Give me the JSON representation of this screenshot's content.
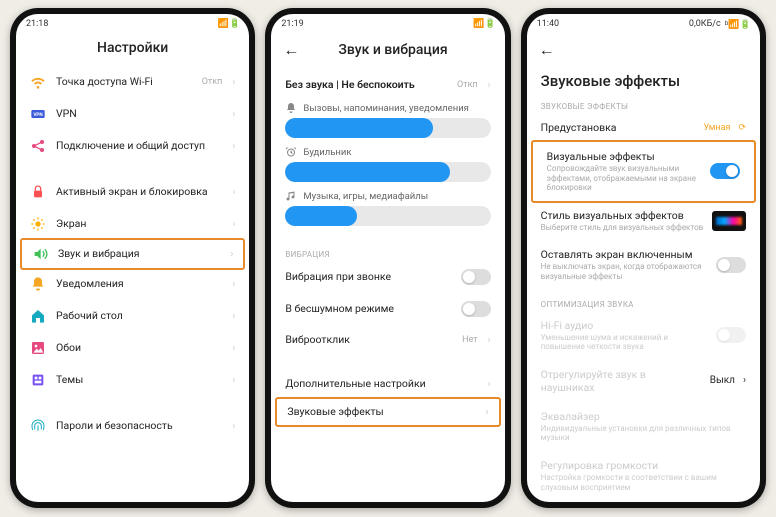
{
  "screen1": {
    "time": "21:18",
    "title": "Настройки",
    "rows": [
      {
        "icon": "wifi",
        "label": "Точка доступа Wi-Fi",
        "value": "Откп"
      },
      {
        "icon": "vpn",
        "label": "VPN"
      },
      {
        "icon": "share",
        "label": "Подключение и общий доступ"
      },
      {
        "gap": true
      },
      {
        "icon": "lock",
        "label": "Активный экран и блокировка"
      },
      {
        "icon": "brightness",
        "label": "Экран"
      },
      {
        "icon": "sound",
        "label": "Звук и вибрация",
        "highlight": true
      },
      {
        "icon": "bell",
        "label": "Уведомления"
      },
      {
        "icon": "home",
        "label": "Рабочий стол"
      },
      {
        "icon": "wallpaper",
        "label": "Обои"
      },
      {
        "icon": "themes",
        "label": "Темы"
      },
      {
        "gap": true
      },
      {
        "icon": "fingerprint",
        "label": "Пароли и безопасность"
      }
    ]
  },
  "screen2": {
    "time": "21:19",
    "title": "Звук и вибрация",
    "silent": {
      "label": "Без звука | Не беспокоить",
      "value": "Откп"
    },
    "sliders": [
      {
        "icon": "bell",
        "label": "Вызовы, напоминания, уведомления",
        "pct": 72
      },
      {
        "icon": "alarm",
        "label": "Будильник",
        "pct": 80
      },
      {
        "icon": "music",
        "label": "Музыка, игры, медиафайлы",
        "pct": 35
      }
    ],
    "vibration_section": "ВИБРАЦИЯ",
    "rows2": [
      {
        "label": "Вибрация при звонке",
        "toggle": false
      },
      {
        "label": "В бесшумном режиме",
        "toggle": false
      },
      {
        "label": "Виброотклик",
        "value": "Нет"
      }
    ],
    "rows3": [
      {
        "label": "Дополнительные настройки"
      },
      {
        "label": "Звуковые эффекты",
        "highlight": true
      }
    ]
  },
  "screen3": {
    "time": "11:40",
    "status_right": "0,0КБ/с",
    "title": "Звуковые эффекты",
    "section1": "ЗВУКОВЫЕ ЭФФЕКТЫ",
    "preset": {
      "label": "Предустановка",
      "value": "Умная"
    },
    "visual": {
      "label": "Визуальные эффекты",
      "sub": "Сопровождайте звук визуальными эффектами, отображаемыми на экране блокировки",
      "on": true,
      "highlight": true
    },
    "style": {
      "label": "Стиль визуальных эффектов",
      "sub": "Выберите стиль для визуальных эффектов"
    },
    "keepon": {
      "label": "Оставлять экран включенным",
      "sub": "Не выключать экран, когда отображаются визуальные эффекты",
      "on": false
    },
    "section2": "ОПТИМИЗАЦИЯ ЗВУКА",
    "hifi": {
      "label": "Hi-Fi аудио",
      "sub": "Уменьшение шума и искажений и повышение четкости звука"
    },
    "headphones": {
      "label": "Отрегулируйте звук в наушниках",
      "value": "Выкл"
    },
    "eq": {
      "label": "Эквалайзер",
      "sub": "Индивидуальные установки для различных типов музыки"
    },
    "volume": {
      "label": "Регулировка громкости",
      "sub": "Настройка громкости в соответствии с вашим слуховым восприятием"
    }
  }
}
